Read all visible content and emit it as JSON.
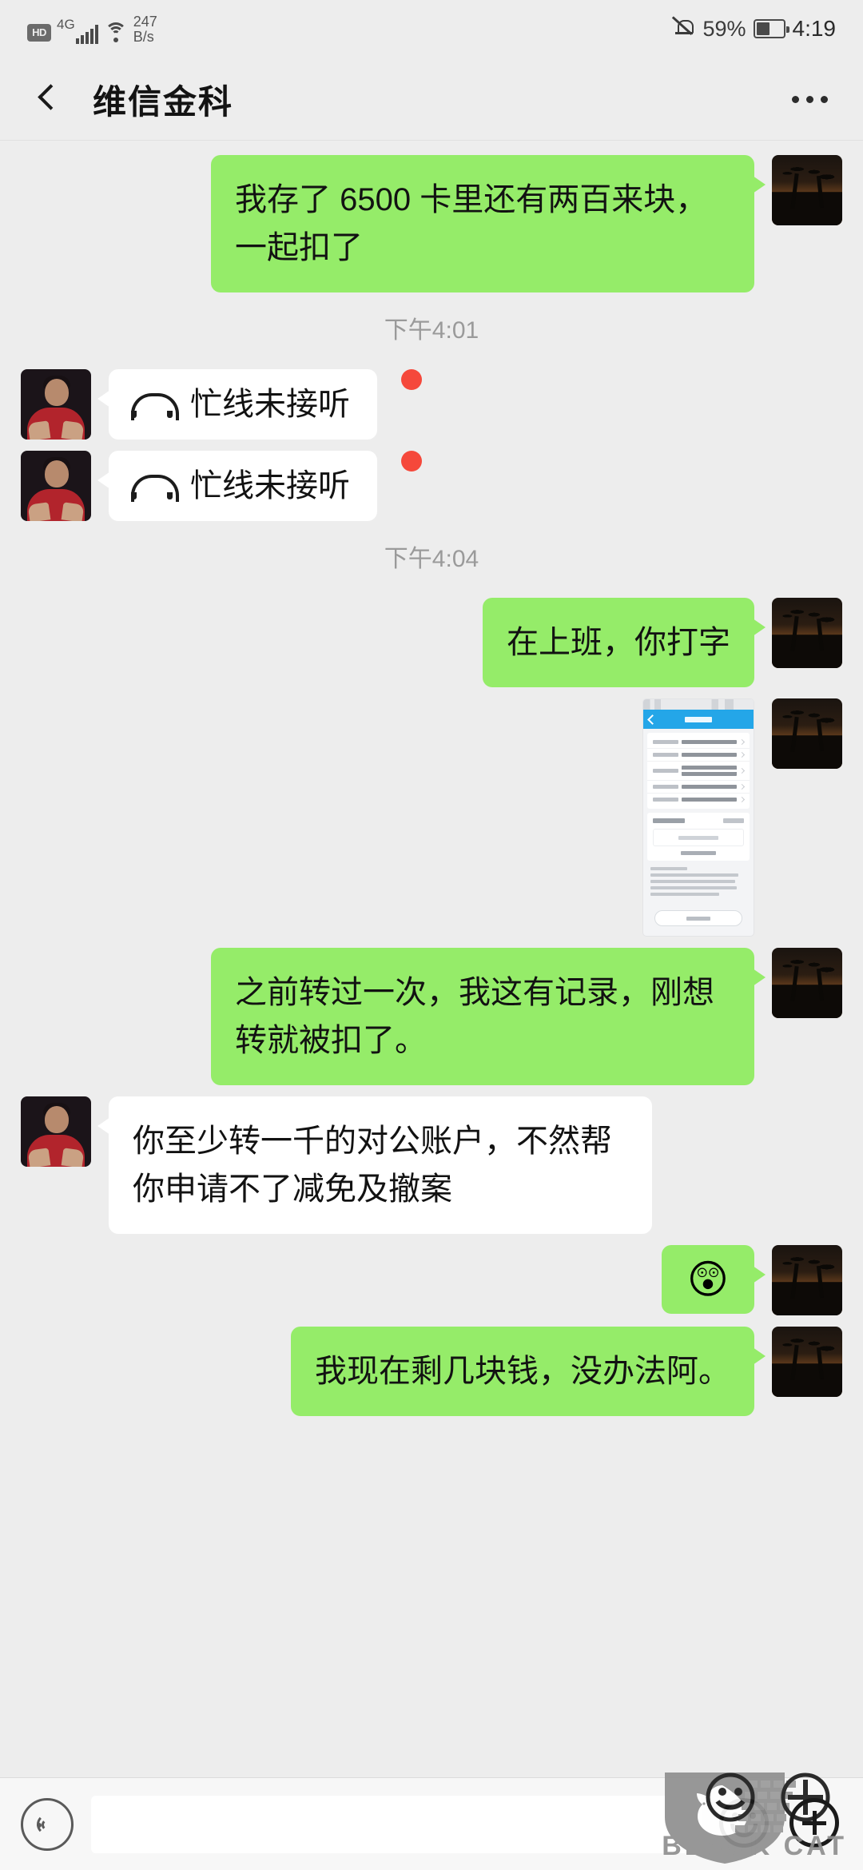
{
  "status_bar": {
    "hd_label": "HD",
    "network_label": "4G",
    "speed_value": "247",
    "speed_unit": "B/s",
    "mute_icon": "bell-muted-icon",
    "battery_percent": "59%",
    "battery_icon": "battery-icon",
    "clock": "4:19"
  },
  "nav": {
    "back_icon": "back-chevron-icon",
    "title": "维信金科",
    "more_icon": "more-options-icon"
  },
  "messages": [
    {
      "type": "text",
      "side": "out",
      "text": "我存了 6500 卡里还有两百来块，一起扣了"
    },
    {
      "type": "timestamp",
      "text": "下午4:01"
    },
    {
      "type": "call",
      "side": "in",
      "icon": "phone-handset-icon",
      "text": "忙线未接听",
      "unread_dot": true
    },
    {
      "type": "call",
      "side": "in",
      "icon": "phone-handset-icon",
      "text": "忙线未接听",
      "unread_dot": true
    },
    {
      "type": "timestamp",
      "text": "下午4:04"
    },
    {
      "type": "text",
      "side": "out",
      "text": "在上班，你打字"
    },
    {
      "type": "image",
      "side": "out",
      "alt": "转账信息填写截图"
    },
    {
      "type": "text",
      "side": "out",
      "text": "之前转过一次，我这有记录，刚想转就被扣了。"
    },
    {
      "type": "text",
      "side": "in",
      "text": "你至少转一千的对公账户，不然帮你申请不了减免及撤案"
    },
    {
      "type": "emoji",
      "side": "out",
      "text": "😲"
    },
    {
      "type": "text",
      "side": "out",
      "text": "我现在剩几块钱，没办法阿。"
    }
  ],
  "input_bar": {
    "voice_icon": "voice-input-icon",
    "input_value": "",
    "input_placeholder": "",
    "emoji_icon": "emoji-icon",
    "plus_icon": "plus-icon"
  },
  "watermark": {
    "logo_icon": "black-cat-logo-icon",
    "text": "BLACK CAT"
  },
  "colors": {
    "chat_background": "#EDEDED",
    "outgoing_bubble": "#95EC69",
    "incoming_bubble": "#FFFFFF",
    "unread_dot": "#F5483B",
    "screenshot_header": "#24A6E8",
    "timestamp_text": "#9A9A9A"
  }
}
